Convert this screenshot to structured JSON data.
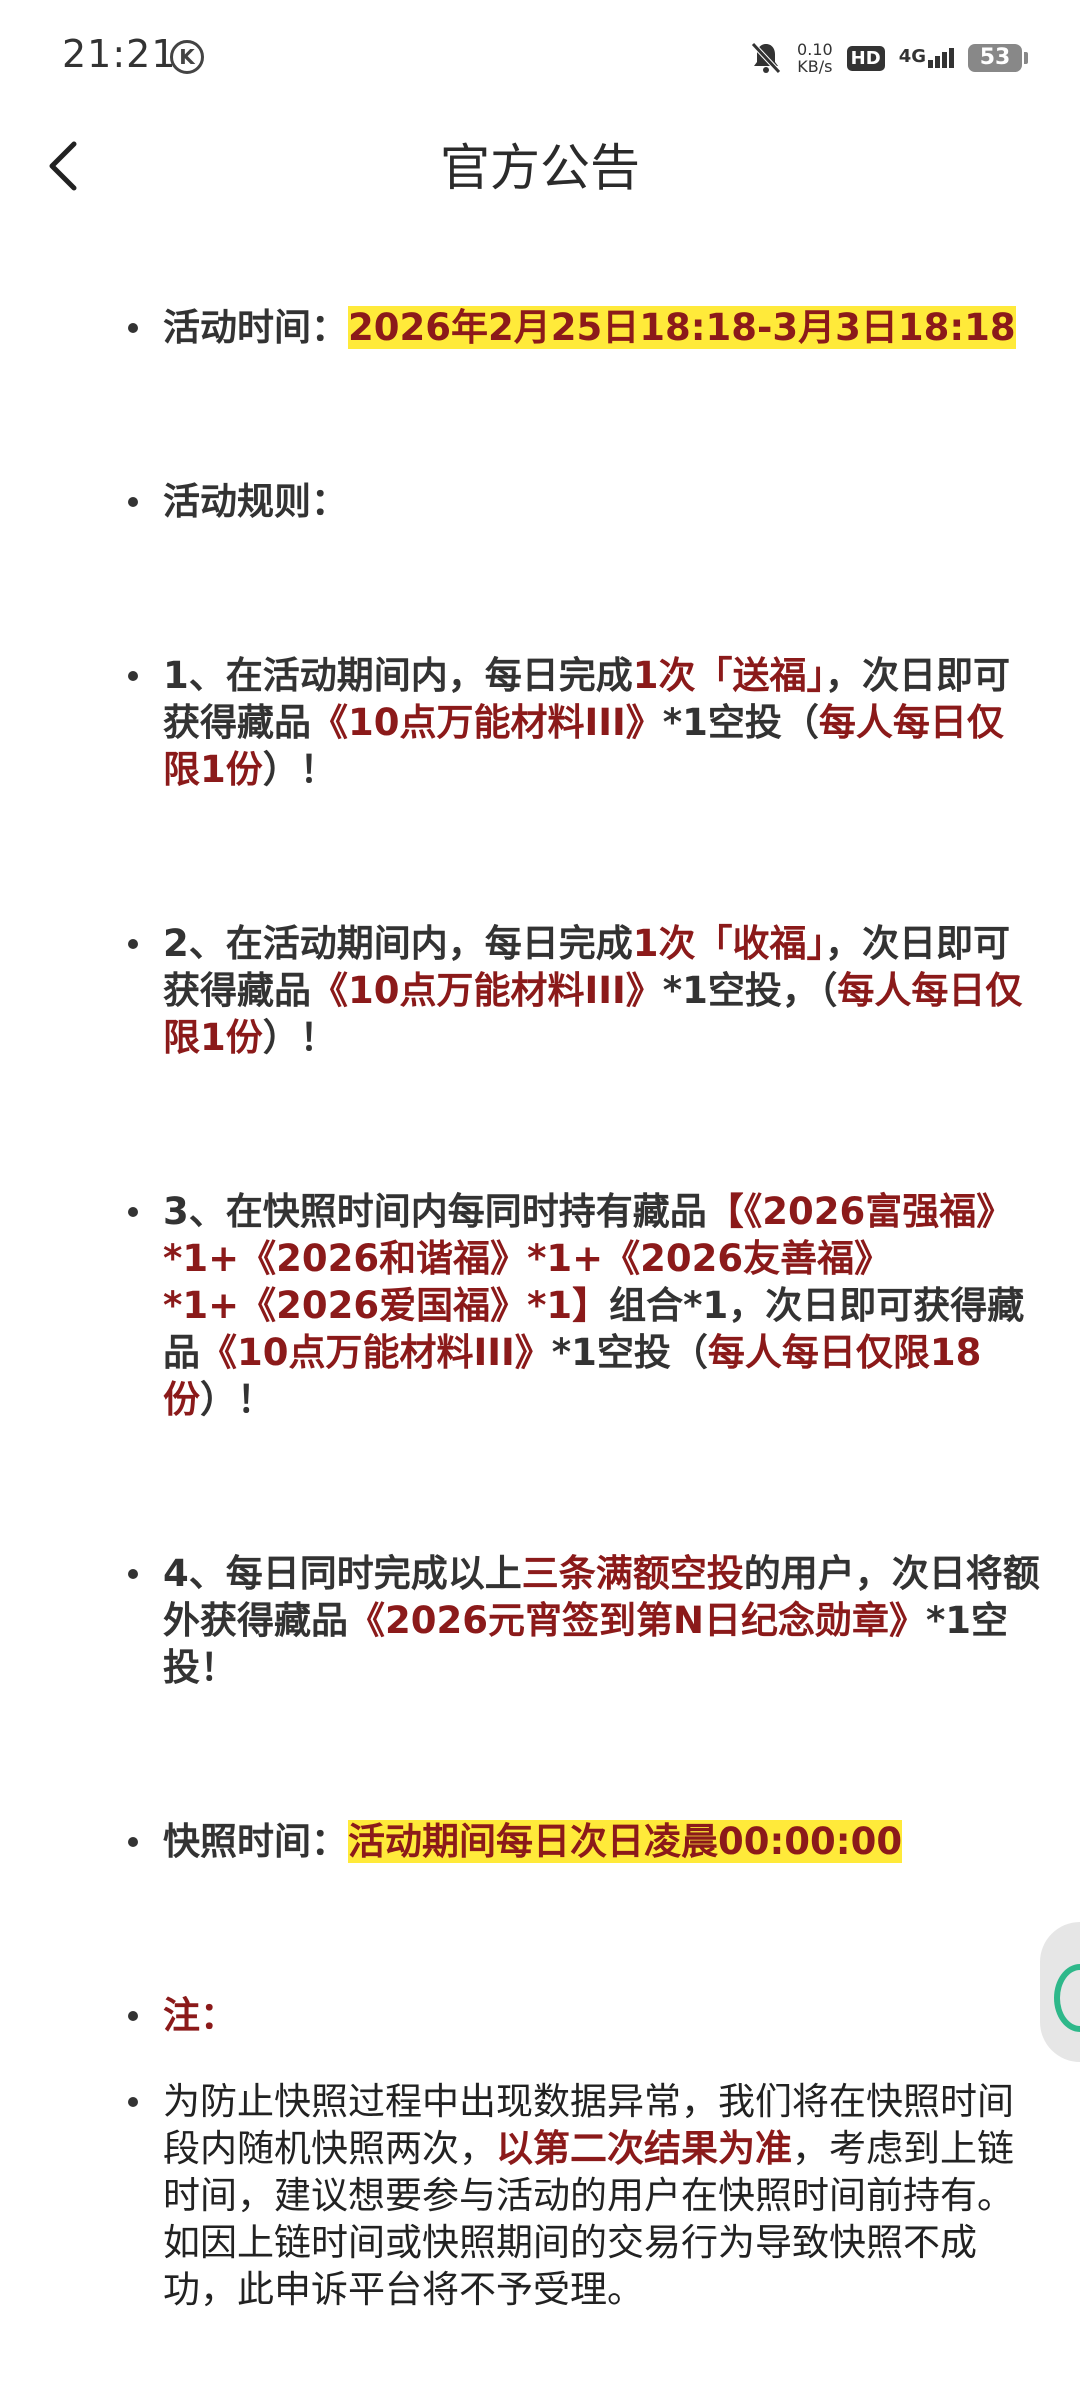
{
  "status_bar": {
    "time": "21:21",
    "k_badge": "K",
    "net_speed_value": "0.10",
    "net_speed_unit": "KB/s",
    "hd": "HD",
    "network": "4G",
    "battery": "53",
    "icons": [
      "mute-bell-icon",
      "k-circle-icon",
      "signal-icon",
      "battery-icon"
    ]
  },
  "header": {
    "back_icon": "chevron-left-icon",
    "title": "官方公告"
  },
  "colors": {
    "accent_red": "#8b1a1a",
    "highlight": "#ffea3a",
    "handle_green": "#2eb88a"
  },
  "content": {
    "time_label": "活动时间：",
    "time_value": "2026年2月25日18:18-3月3日18:18",
    "rules_label": "活动规则：",
    "rule1": {
      "a": " 1、在活动期间内，每日完成",
      "b": "1次「送福」",
      "c": "，次日即可获得藏品",
      "d": "《10点万能材料III》",
      "e": "*1空投（",
      "f": "每人每日仅限1份",
      "g": "）！"
    },
    "rule2": {
      "a": "2、在活动期间内，每日完成",
      "b": "1次「收福」",
      "c": "，次日即可获得藏品",
      "d": "《10点万能材料III》",
      "e": "*1空投，（",
      "f": "每人每日仅限1份",
      "g": "）！"
    },
    "rule3": {
      "a": "3、在快照时间内每同时持有藏品",
      "b": "【《2026富强福》*1+《2026和谐福》*1+《2026友善福》*1+《2026爱国福》*1】",
      "c": "组合*1，次日即可获得藏品",
      "d": "《10点万能材料III》",
      "e": "*1空投（",
      "f": "每人每日仅限18份",
      "g": "）！"
    },
    "rule4": {
      "a": "4、每日同时完成以上",
      "b": "三条满额空投",
      "c": "的用户，次日将额外获得藏品",
      "d": "《2026元宵签到第N日纪念勋章》",
      "e": "*1空投！"
    },
    "snapshot_label": "快照时间：",
    "snapshot_value": "活动期间每日次日凌晨00:00:00",
    "note_label": "注：",
    "note": {
      "a": "为防止快照过程中出现数据异常，我们将在快照时间段内随机快照两次，",
      "b": "以第二次结果为准",
      "c": "，考虑到上链时间，建议想要参与活动的用户在快照时间前持有。如因上链时间或快照期间的交易行为导致快照不成功，此申诉平台将不予受理。"
    }
  }
}
